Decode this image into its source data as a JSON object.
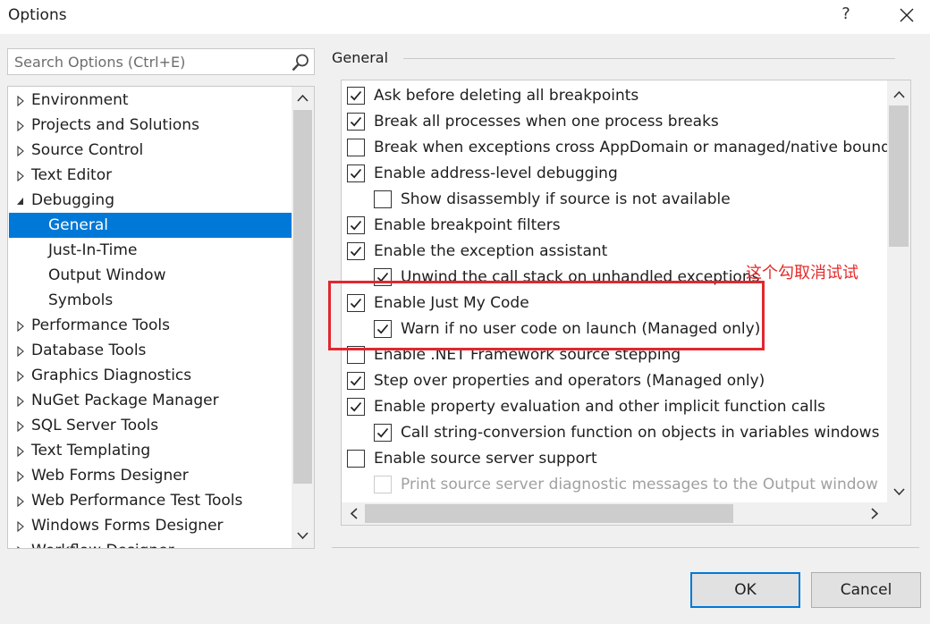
{
  "window": {
    "title": "Options",
    "help_label": "?"
  },
  "search": {
    "placeholder": "Search Options (Ctrl+E)",
    "value": ""
  },
  "tree": {
    "items": [
      {
        "label": "Environment",
        "level": 0,
        "expander": "collapsed"
      },
      {
        "label": "Projects and Solutions",
        "level": 0,
        "expander": "collapsed"
      },
      {
        "label": "Source Control",
        "level": 0,
        "expander": "collapsed"
      },
      {
        "label": "Text Editor",
        "level": 0,
        "expander": "collapsed"
      },
      {
        "label": "Debugging",
        "level": 0,
        "expander": "expanded"
      },
      {
        "label": "General",
        "level": 1,
        "expander": "none",
        "selected": true
      },
      {
        "label": "Just-In-Time",
        "level": 1,
        "expander": "none"
      },
      {
        "label": "Output Window",
        "level": 1,
        "expander": "none"
      },
      {
        "label": "Symbols",
        "level": 1,
        "expander": "none"
      },
      {
        "label": "Performance Tools",
        "level": 0,
        "expander": "collapsed"
      },
      {
        "label": "Database Tools",
        "level": 0,
        "expander": "collapsed"
      },
      {
        "label": "Graphics Diagnostics",
        "level": 0,
        "expander": "collapsed"
      },
      {
        "label": "NuGet Package Manager",
        "level": 0,
        "expander": "collapsed"
      },
      {
        "label": "SQL Server Tools",
        "level": 0,
        "expander": "collapsed"
      },
      {
        "label": "Text Templating",
        "level": 0,
        "expander": "collapsed"
      },
      {
        "label": "Web Forms Designer",
        "level": 0,
        "expander": "collapsed"
      },
      {
        "label": "Web Performance Test Tools",
        "level": 0,
        "expander": "collapsed"
      },
      {
        "label": "Windows Forms Designer",
        "level": 0,
        "expander": "collapsed"
      },
      {
        "label": "Workflow Designer",
        "level": 0,
        "expander": "collapsed"
      }
    ]
  },
  "general": {
    "group_label": "General",
    "options": [
      {
        "label": "Ask before deleting all breakpoints",
        "checked": true,
        "indent": 0,
        "enabled": true
      },
      {
        "label": "Break all processes when one process breaks",
        "checked": true,
        "indent": 0,
        "enabled": true
      },
      {
        "label": "Break when exceptions cross AppDomain or managed/native boundaries",
        "checked": false,
        "indent": 0,
        "enabled": true
      },
      {
        "label": "Enable address-level debugging",
        "checked": true,
        "indent": 0,
        "enabled": true
      },
      {
        "label": "Show disassembly if source is not available",
        "checked": false,
        "indent": 1,
        "enabled": true
      },
      {
        "label": "Enable breakpoint filters",
        "checked": true,
        "indent": 0,
        "enabled": true
      },
      {
        "label": "Enable the exception assistant",
        "checked": true,
        "indent": 0,
        "enabled": true
      },
      {
        "label": "Unwind the call stack on unhandled exceptions",
        "checked": true,
        "indent": 1,
        "enabled": true
      },
      {
        "label": "Enable Just My Code",
        "checked": true,
        "indent": 0,
        "enabled": true
      },
      {
        "label": "Warn if no user code on launch (Managed only)",
        "checked": true,
        "indent": 1,
        "enabled": true
      },
      {
        "label": "Enable .NET Framework source stepping",
        "checked": false,
        "indent": 0,
        "enabled": true
      },
      {
        "label": "Step over properties and operators (Managed only)",
        "checked": true,
        "indent": 0,
        "enabled": true
      },
      {
        "label": "Enable property evaluation and other implicit function calls",
        "checked": true,
        "indent": 0,
        "enabled": true
      },
      {
        "label": "Call string-conversion function on objects in variables windows",
        "checked": true,
        "indent": 1,
        "enabled": true
      },
      {
        "label": "Enable source server support",
        "checked": false,
        "indent": 0,
        "enabled": true
      },
      {
        "label": "Print source server diagnostic messages to the Output window",
        "checked": false,
        "indent": 1,
        "enabled": false
      }
    ]
  },
  "annotation": {
    "text": "这个勾取消试试",
    "color": "#e0282e"
  },
  "buttons": {
    "ok": "OK",
    "cancel": "Cancel"
  },
  "colors": {
    "accent": "#0078d7",
    "highlight_box": "#e0282e"
  }
}
